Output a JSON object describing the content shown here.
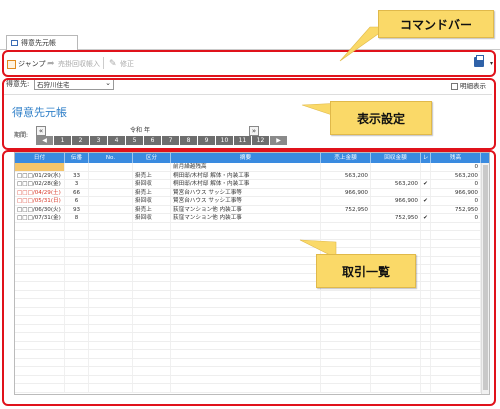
{
  "tab": {
    "label": "得意先元帳"
  },
  "toolbar": {
    "jump": "ジャンプ",
    "history_input": "売掛回収帳入",
    "correct": "修正"
  },
  "filter": {
    "label": "得意先:",
    "value": "石狩川住宅",
    "show_detail": "明細表示"
  },
  "settings": {
    "title": "得意先元帳",
    "period_label": "期間:",
    "year": "令和",
    "year_suffix": "年",
    "prev": "«",
    "next": "»",
    "months": [
      "1",
      "2",
      "3",
      "4",
      "5",
      "6",
      "7",
      "8",
      "9",
      "10",
      "11",
      "12"
    ],
    "start_cell": "◀",
    "end_cell": "▶"
  },
  "grid": {
    "columns": [
      "日付",
      "伝番",
      "No.",
      "区分",
      "摘要",
      "売上金額",
      "回収金額",
      "レ",
      "残高"
    ],
    "rows": [
      {
        "date": "",
        "denban": "",
        "no": "",
        "kubun": "",
        "summary": "前月繰越残高",
        "sales": "",
        "collected": "",
        "check": "",
        "balance": "0"
      },
      {
        "date": "□□□/01/29(水)",
        "denban": "33",
        "no": "",
        "kubun": "掛売上",
        "summary": "桐田邸/木村邸 解体・内装工事",
        "sales": "563,200",
        "collected": "",
        "check": "",
        "balance": "563,200"
      },
      {
        "date": "□□□/02/28(金)",
        "denban": "3",
        "no": "",
        "kubun": "掛回収",
        "summary": "桐田邸/木村邸 解体・内装工事",
        "sales": "",
        "collected": "563,200",
        "check": "✔",
        "balance": "0"
      },
      {
        "date": "□□□/04/29(土)",
        "denban": "66",
        "no": "",
        "kubun": "掛売上",
        "summary": "賢宮台ハウス サッシ工事等",
        "sales": "966,900",
        "collected": "",
        "check": "",
        "balance": "966,900"
      },
      {
        "date": "□□□/05/31(日)",
        "denban": "6",
        "no": "",
        "kubun": "掛回収",
        "summary": "賢宮台ハウス サッシ工事等",
        "sales": "",
        "collected": "966,900",
        "check": "✔",
        "balance": "0"
      },
      {
        "date": "□□□/06/30(火)",
        "denban": "93",
        "no": "",
        "kubun": "掛売上",
        "summary": "荻窪マンション他 内装工事",
        "sales": "752,950",
        "collected": "",
        "check": "",
        "balance": "752,950"
      },
      {
        "date": "□□□/07/31(金)",
        "denban": "8",
        "no": "",
        "kubun": "掛回収",
        "summary": "荻窪マンション他 内装工事",
        "sales": "",
        "collected": "752,950",
        "check": "✔",
        "balance": "0"
      }
    ]
  },
  "callouts": {
    "command_bar": "コマンドバー",
    "display_settings": "表示設定",
    "transactions": "取引一覧"
  },
  "colors": {
    "callout_bg": "#fad968",
    "frame": "#e0121b",
    "grid_header": "#3a8be0",
    "title_blue": "#2f7fc8"
  }
}
